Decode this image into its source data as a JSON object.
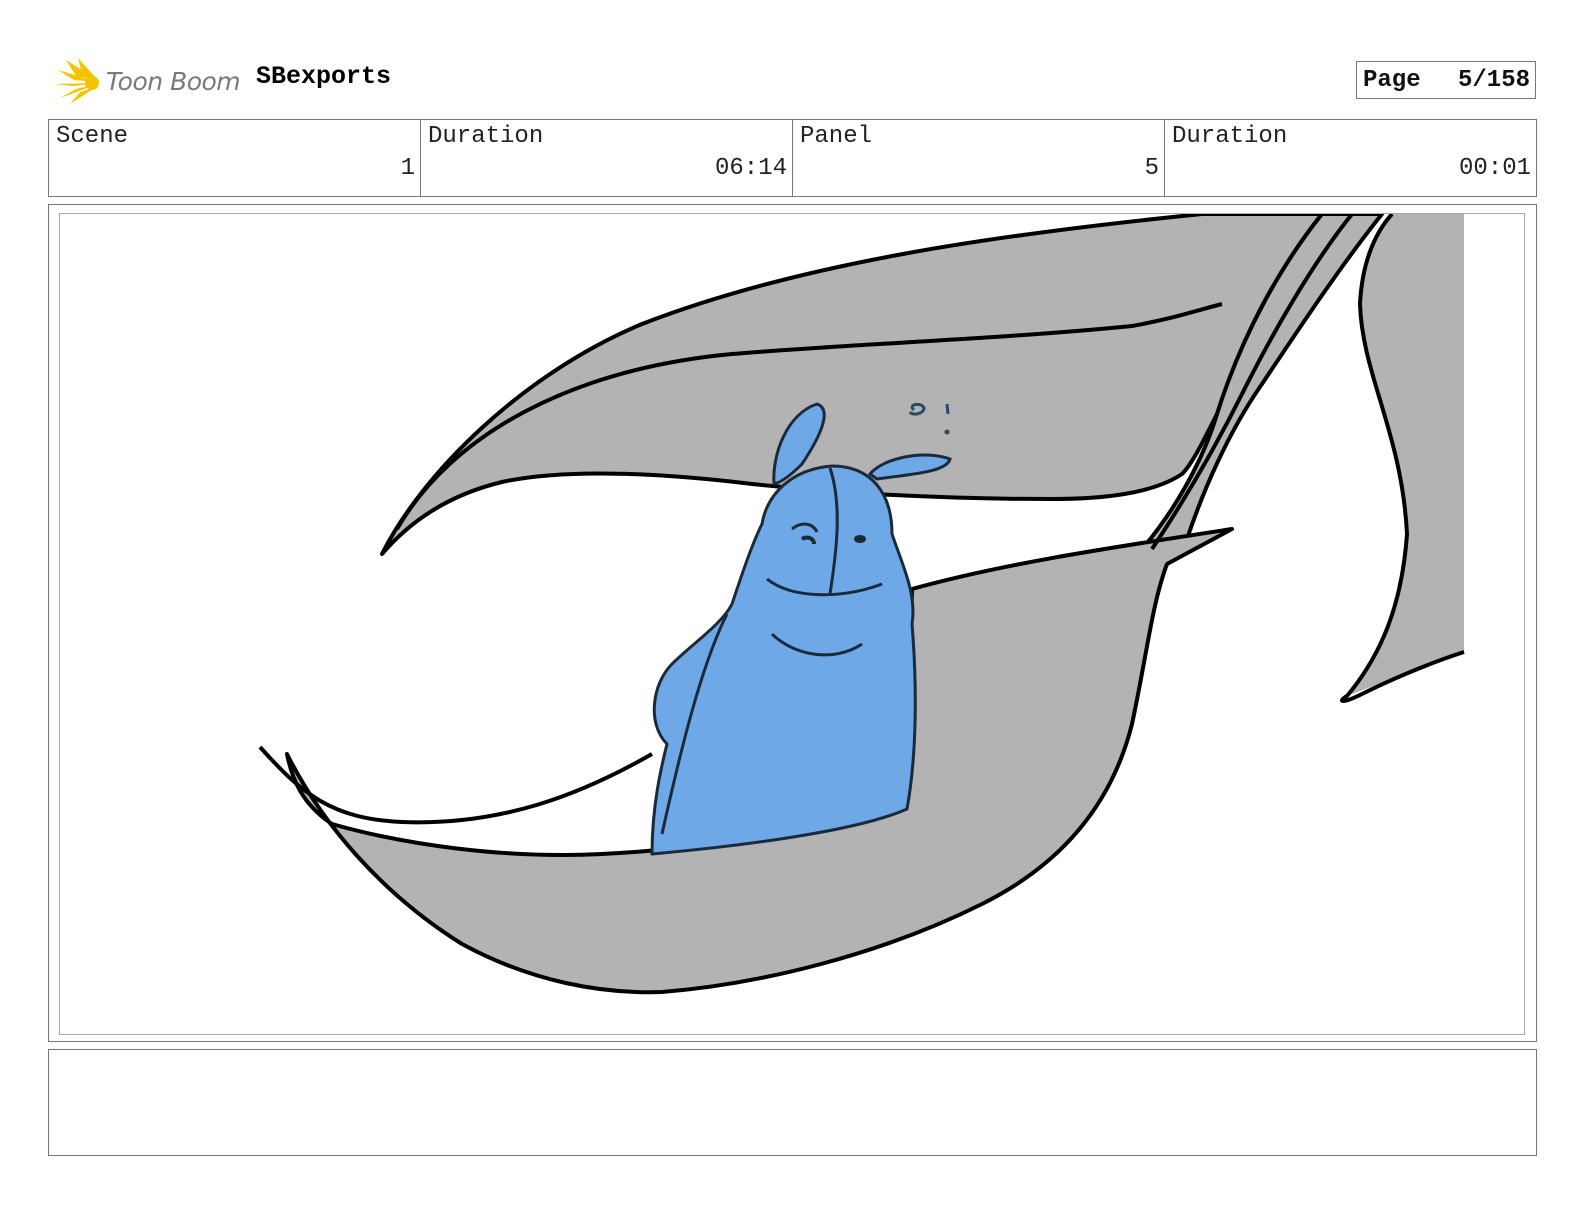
{
  "header": {
    "brand": "Toon Boom",
    "project_title": "SBexports",
    "page_label": "Page",
    "page_value": "5/158"
  },
  "info": {
    "scene_label": "Scene",
    "scene_value": "1",
    "scene_duration_label": "Duration",
    "scene_duration_value": "06:14",
    "panel_label": "Panel",
    "panel_value": "5",
    "panel_duration_label": "Duration",
    "panel_duration_value": "00:01"
  },
  "notes": {
    "text": ""
  },
  "colors": {
    "leaf_fill": "#b3b3b3",
    "character_fill": "#6fa8e6",
    "line": "#000000",
    "logo": "#f5c400"
  }
}
